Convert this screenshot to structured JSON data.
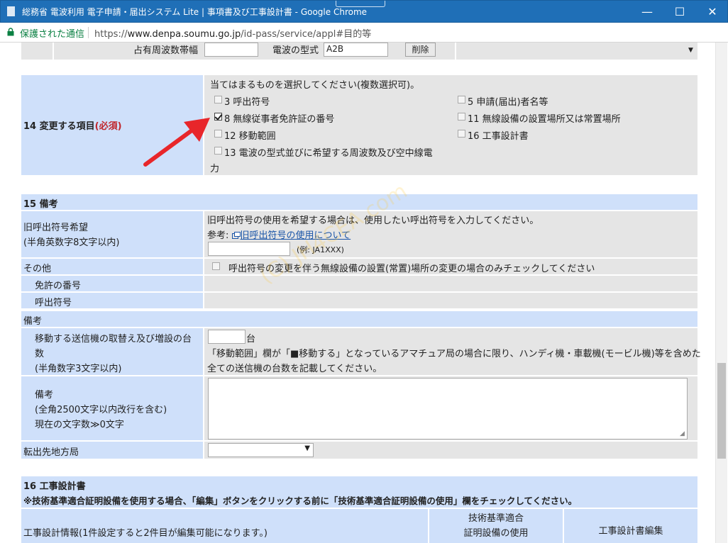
{
  "window": {
    "title": "総務省 電波利用 電子申請・届出システム Lite | 事項書及び工事設計書 - Google Chrome",
    "minimize": "—",
    "maximize": "☐",
    "close": "✕"
  },
  "address": {
    "secure_label": "保護された通信",
    "url_prefix": "https://",
    "url_host": "www.denpa.soumu.go.jp",
    "url_path": "/id-pass/service/appl#目的等"
  },
  "top_row": {
    "bandwidth_label": "占有周波数帯幅",
    "bandwidth_value": "",
    "emission_label": "電波の型式",
    "emission_value": "A2B",
    "delete_button": "削除"
  },
  "section14": {
    "label": "14 変更する項目",
    "required": "(必須)",
    "instruction": "当てはまるものを選択してください(複数選択可)。",
    "options": [
      {
        "label": "3 呼出符号",
        "checked": false
      },
      {
        "label": "8 無線従事者免許証の番号",
        "checked": true
      },
      {
        "label": "12 移動範囲",
        "checked": false
      },
      {
        "label": "13 電波の型式並びに希望する周波数及び空中線電",
        "checked": false
      },
      {
        "label": "5 申請(届出)者名等",
        "checked": false
      },
      {
        "label": "11 無線設備の設置場所又は常置場所",
        "checked": false
      },
      {
        "label": "16 工事設計書",
        "checked": false
      }
    ],
    "option13_wrap": "力"
  },
  "section15": {
    "header": "15 備考",
    "old_callsign": {
      "label1": "旧呼出符号希望",
      "label2": "(半角英数字8文字以内)",
      "desc": "旧呼出符号の使用を希望する場合は、使用したい呼出符号を入力してください。",
      "ref_label": "参考:",
      "ref_link": "旧呼出符号の使用について",
      "value": "",
      "example": "(例: JA1XXX)"
    },
    "other": {
      "label": "その他",
      "check_text": "呼出符号の変更を伴う無線設備の設置(常置)場所の変更の場合のみチェックしてください",
      "license_label": "免許の番号",
      "callsign_label": "呼出符号"
    },
    "remarks_header": "備考",
    "transmitters": {
      "label1": "移動する送信機の取替え及び増設の台",
      "label2": "数",
      "label3": "(半角数字3文字以内)",
      "value": "",
      "unit": "台",
      "note1": "「移動範囲」欄が「■移動する」となっているアマチュア局の場合に限り、ハンディ機・車載機(モービル機)等を含めた",
      "note2": "全ての送信機の台数を記載してください。"
    },
    "remarks": {
      "label1": "備考",
      "label2": "(全角2500文字以内改行を含む)",
      "label3": "現在の文字数≫0文字",
      "value": ""
    },
    "transfer": {
      "label": "転出先地方局",
      "selected": ""
    }
  },
  "section16": {
    "header": "16 工事設計書",
    "note": "※技術基準適合証明設備を使用する場合、「編集」ボタンをクリックする前に「技術基準適合証明設備の使用」欄をチェックしてください。",
    "info_label": "工事設計情報(1件設定すると2件目が編集可能になります。)",
    "col_cert1": "技術基準適合",
    "col_cert2": "証明設備の使用",
    "col_edit": "工事設計書編集"
  },
  "watermark": "(C) JH4CEA.com",
  "colors": {
    "label_bg": "#cfe0fa",
    "content_bg": "#e5e5e5",
    "titlebar": "#1f6fb7",
    "required": "#c0262c",
    "arrow": "#e8262a"
  }
}
